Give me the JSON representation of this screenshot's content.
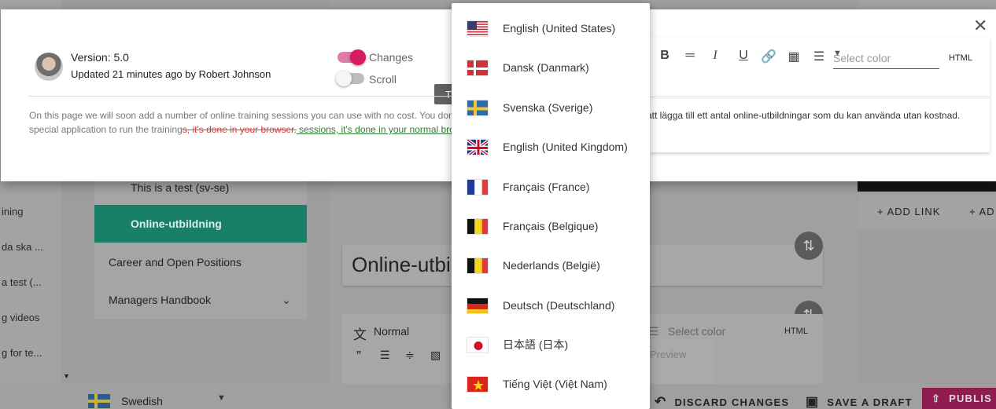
{
  "background": {
    "left_list": [
      "ining",
      "da ska ...",
      "a test (...",
      "g videos",
      "g for te..."
    ],
    "nav_items": [
      {
        "label": "This is a test (sv-se)",
        "active": false
      },
      {
        "label": "Online-utbildning",
        "active": true
      },
      {
        "label": "Career and Open Positions",
        "active": false
      },
      {
        "label": "Managers Handbook",
        "active": false,
        "expandable": true
      }
    ],
    "page_title": "Online-utbi",
    "editor": {
      "format": "Normal",
      "select_color": "Select color",
      "html": "HTML",
      "preview": "Preview"
    },
    "add_link": "+ ADD LINK",
    "add_link_2": "+ AD"
  },
  "bottom_bar": {
    "language": "Swedish",
    "discard": "DISCARD CHANGES",
    "save_draft": "SAVE A DRAFT",
    "publish": "PUBLIS"
  },
  "dialog": {
    "version": "Version: 5.0",
    "updated": "Updated 21 minutes ago by Robert Johnson",
    "changes_label": "Changes",
    "changes_on": true,
    "scroll_label": "Scroll",
    "scroll_on": false,
    "tooltip": "Tr",
    "left_text_1": "On this page we will soon add a number of online training sessions you can use with no cost. You dont a",
    "left_text_2_plain": "special application to run the training",
    "left_text_2_deleted": "s, it's done in your browser.",
    "left_text_2_inserted": " sessions, it's done in your normal brows",
    "toolbar": {
      "select_color": "Select color",
      "html": "HTML"
    },
    "right_text": "att lägga till ett antal online-utbildningar som du kan använda utan kostnad."
  },
  "languages": [
    {
      "label": "English (United States)",
      "flag": "us-flag"
    },
    {
      "label": "Dansk (Danmark)",
      "flag": "dk-flag"
    },
    {
      "label": "Svenska (Sverige)",
      "flag": "se-flag"
    },
    {
      "label": "English (United Kingdom)",
      "flag": "gb-flag"
    },
    {
      "label": "Français (France)",
      "flag": "fr-flag"
    },
    {
      "label": "Français (Belgique)",
      "flag": "be-flag"
    },
    {
      "label": "Nederlands (België)",
      "flag": "be-flag"
    },
    {
      "label": "Deutsch (Deutschland)",
      "flag": "de-flag"
    },
    {
      "label": "日本語 (日本)",
      "flag": "jp-flag"
    },
    {
      "label": "Tiếng Việt (Việt Nam)",
      "flag": "vn-flag"
    }
  ],
  "colors": {
    "accent": "#d81b60",
    "nav_active": "#1a7f68",
    "publish": "#8e1c50"
  }
}
